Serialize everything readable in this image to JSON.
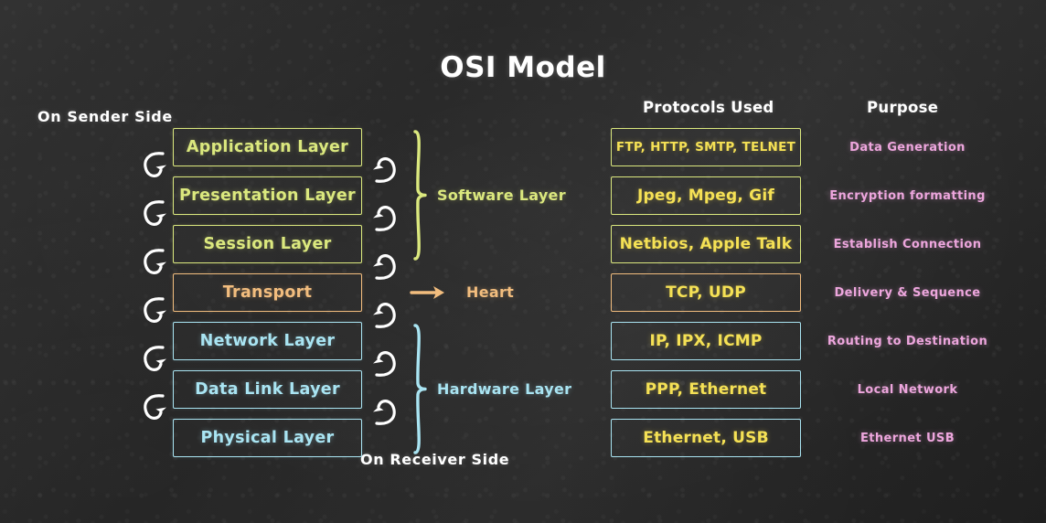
{
  "title": "OSI Model",
  "headers": {
    "sender_side": "On Sender Side",
    "receiver_side": "On Receiver Side",
    "protocols": "Protocols Used",
    "purpose": "Purpose"
  },
  "colors": {
    "background": "#262626",
    "white": "#ffffff",
    "software_green": "#dbe87e",
    "transport_orange": "#f2bd7e",
    "hardware_blue": "#a9e4f2",
    "protocol_yellow": "#f5e155",
    "purpose_pink": "#eda6dd"
  },
  "groups": [
    {
      "label": "Software Layer",
      "color": "#dbe87e",
      "kind": "brace"
    },
    {
      "label": "Heart",
      "color": "#f2bd7e",
      "kind": "arrow"
    },
    {
      "label": "Hardware Layer",
      "color": "#a9e4f2",
      "kind": "brace"
    }
  ],
  "rows": [
    {
      "layer": "Application Layer",
      "protocol": "FTP, HTTP, SMTP, TELNET",
      "purpose": "Data Generation",
      "color": "#dbe87e",
      "protocol_small": true
    },
    {
      "layer": "Presentation Layer",
      "protocol": "Jpeg, Mpeg, Gif",
      "purpose": "Encryption formatting",
      "color": "#dbe87e",
      "protocol_small": false
    },
    {
      "layer": "Session Layer",
      "protocol": "Netbios, Apple Talk",
      "purpose": "Establish Connection",
      "color": "#dbe87e",
      "protocol_small": false
    },
    {
      "layer": "Transport",
      "protocol": "TCP, UDP",
      "purpose": "Delivery & Sequence",
      "color": "#f2bd7e",
      "protocol_small": false
    },
    {
      "layer": "Network Layer",
      "protocol": "IP, IPX, ICMP",
      "purpose": "Routing to Destination",
      "color": "#a9e4f2",
      "protocol_small": false
    },
    {
      "layer": "Data Link Layer",
      "protocol": "PPP, Ethernet",
      "purpose": "Local Network",
      "color": "#a9e4f2",
      "protocol_small": false
    },
    {
      "layer": "Physical Layer",
      "protocol": "Ethernet, USB",
      "purpose": "Ethernet USB",
      "color": "#a9e4f2",
      "protocol_small": false
    }
  ],
  "icons": {
    "down_arrow": "curved-down-arrow-icon",
    "up_arrow": "curved-up-arrow-icon",
    "heart_arrow": "right-arrow-icon",
    "software_brace": "curly-brace-icon",
    "hardware_brace": "curly-brace-icon"
  }
}
